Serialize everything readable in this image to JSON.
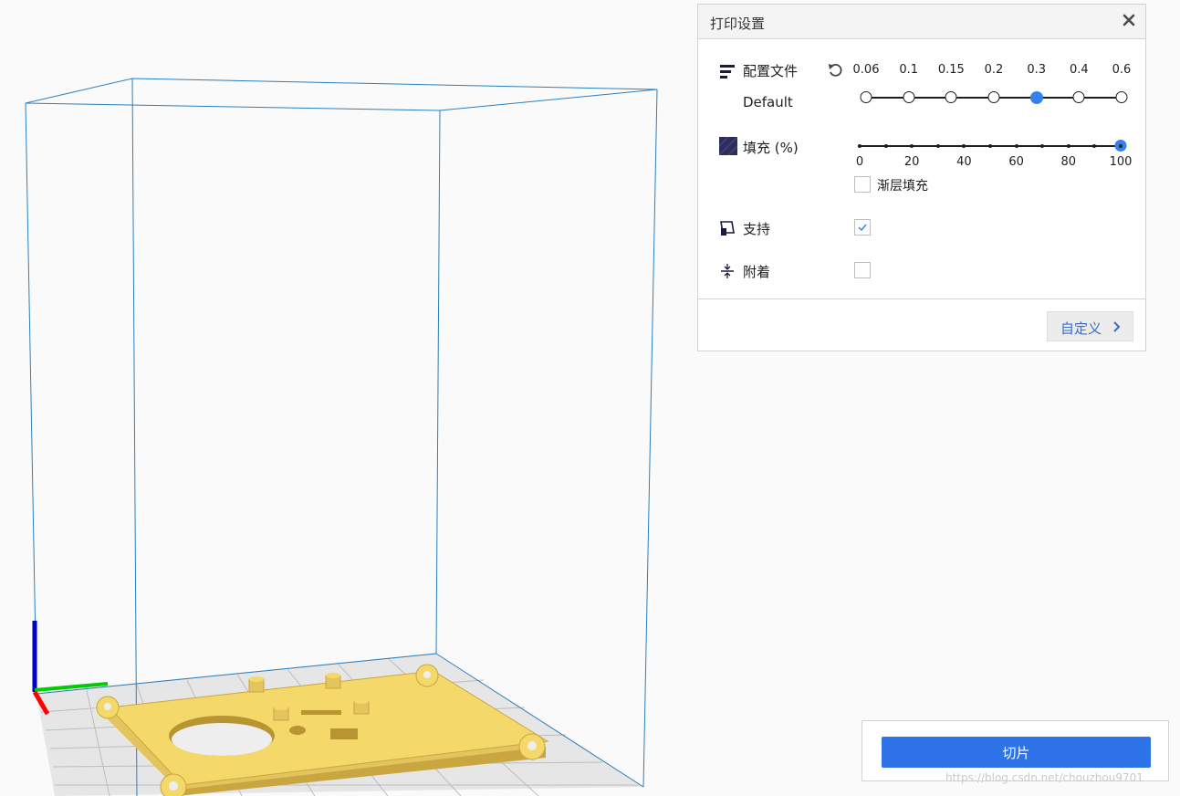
{
  "panel": {
    "title": "打印设置",
    "close_icon": "close-icon",
    "profile": {
      "label": "配置文件",
      "icon": "layer-profile-icon",
      "reset_icon": "reset-icon",
      "name": "Default",
      "layer_heights": [
        "0.06",
        "0.1",
        "0.15",
        "0.2",
        "0.3",
        "0.4",
        "0.6"
      ],
      "selected": "0.3"
    },
    "infill": {
      "label": "填充 (%)",
      "icon": "infill-icon",
      "ticks": [
        "0",
        "20",
        "40",
        "60",
        "80",
        "100"
      ],
      "value": 100,
      "gradual_label": "渐层填充",
      "gradual_checked": false
    },
    "support": {
      "label": "支持",
      "icon": "support-icon",
      "checked": true
    },
    "adhesion": {
      "label": "附着",
      "icon": "adhesion-icon",
      "checked": false
    },
    "custom_button": "自定义"
  },
  "slice": {
    "button_label": "切片"
  },
  "watermark": "https://blog.csdn.net/chouzhou9701",
  "colors": {
    "accent": "#3282f0",
    "build_volume": "#2a7fc0",
    "model": "#f5d86a",
    "axis_x": "#ff0000",
    "axis_y": "#00cc00",
    "axis_z": "#0000cc"
  }
}
